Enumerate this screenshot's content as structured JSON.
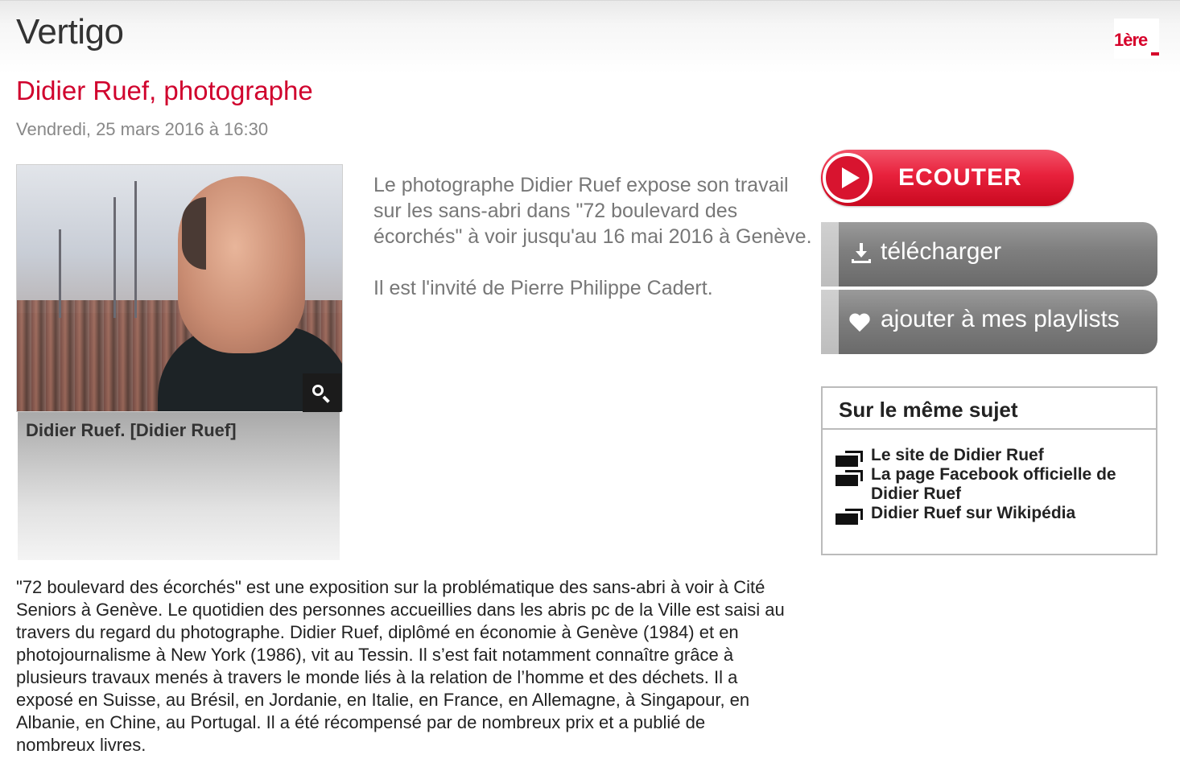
{
  "header": {
    "show_title": "Vertigo",
    "logo_text": "1ère",
    "brand_color": "#d6002a"
  },
  "episode": {
    "title": "Didier Ruef, photographe",
    "date": "Vendredi, 25 mars 2016 à 16:30",
    "title_color": "#d0022d"
  },
  "photo": {
    "caption": "Didier Ruef. [Didier Ruef]",
    "zoom_icon": "magnifier-icon"
  },
  "summary": {
    "paragraphs": [
      "Le photographe Didier Ruef expose son travail sur les sans-abri dans \"72 boulevard des écorchés\" à voir jusqu'au 16 mai 2016 à Genève.",
      "Il est l'invité de Pierre Philippe Cadert."
    ]
  },
  "actions": {
    "listen_label": "ECOUTER",
    "download_label": "télécharger",
    "playlist_label": "ajouter à mes playlists",
    "listen_color": "#e8213c"
  },
  "related": {
    "title": "Sur le même sujet",
    "links": [
      "Le site de Didier Ruef",
      "La page Facebook officielle de Didier Ruef",
      "Didier Ruef sur Wikipédia"
    ]
  },
  "body": {
    "text": "\"72 boulevard des écorchés\" est une exposition sur la problématique des sans-abri à voir à Cité Seniors à Genève. Le quotidien des personnes accueillies dans les abris pc de la Ville est saisi au travers du regard du photographe. Didier Ruef, diplômé en économie à Genève (1984) et en photojournalisme à New York (1986), vit au Tessin. Il s’est fait notamment connaître grâce à plusieurs travaux menés à travers le monde liés à la relation de l’homme et des déchets. Il a exposé en Suisse, au Brésil, en Jordanie, en Italie, en France, en Allemagne, à Singapour, en Albanie, en Chine, au Portugal. Il a été récompensé par de nombreux prix et a publié de nombreux livres."
  }
}
